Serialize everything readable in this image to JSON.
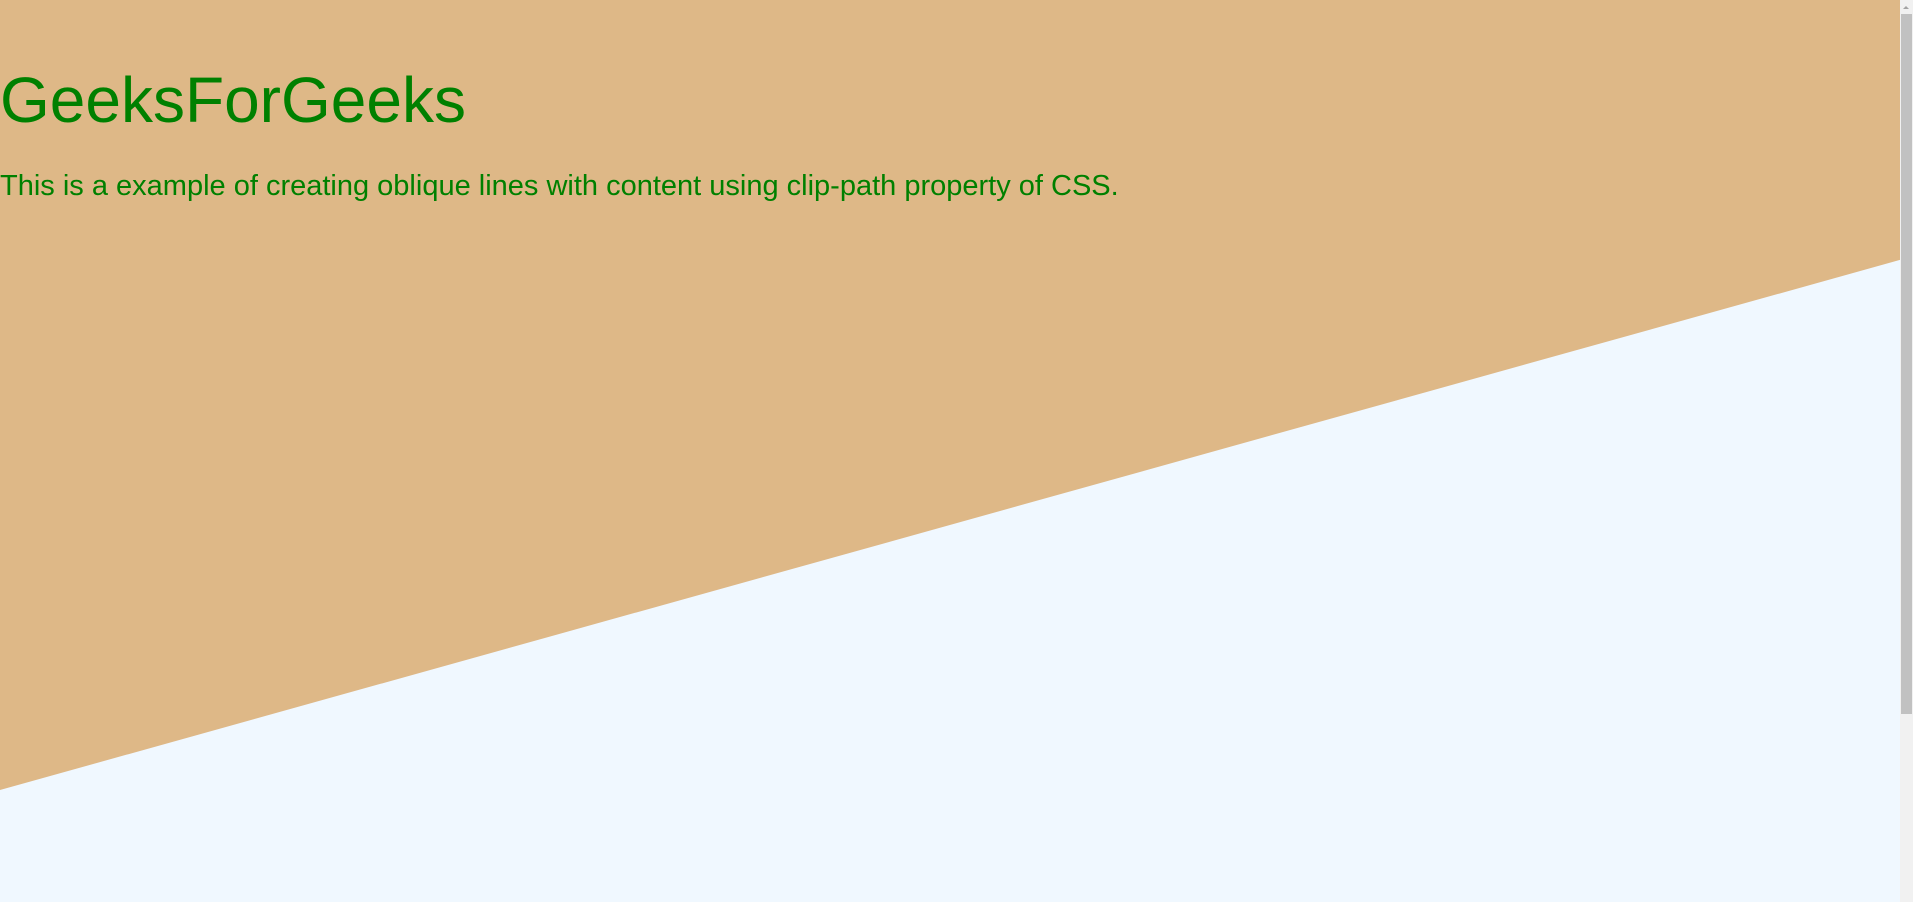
{
  "page": {
    "title": "GeeksForGeeks",
    "description": "This is a example of creating oblique lines with content using clip-path property of CSS."
  },
  "colors": {
    "background": "#f0f8ff",
    "oblique_section": "#deb887",
    "text": "#008000",
    "scrollbar_track": "#f1f1f1",
    "scrollbar_thumb": "#c1c1c1"
  }
}
